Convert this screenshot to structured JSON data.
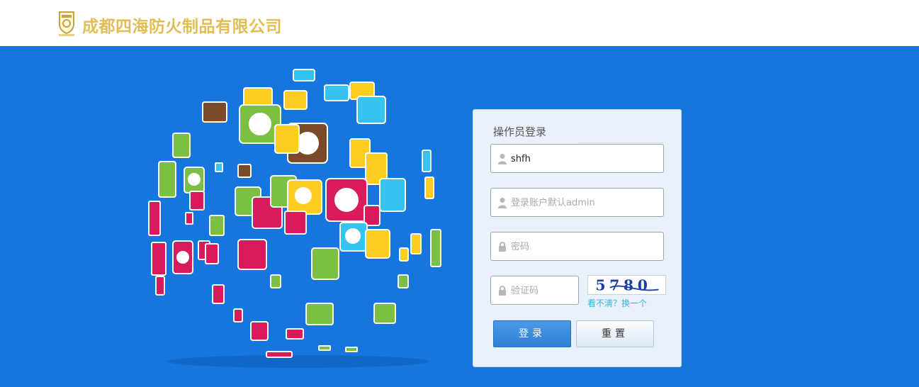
{
  "header": {
    "company_name": "成都四海防火制品有限公司",
    "logo": "shield-crest-logo",
    "brand_color": "#e0bd55"
  },
  "banner": {
    "background_color": "#1676dd",
    "illustration": "tile-globe-illustration"
  },
  "login": {
    "title": "操作员登录",
    "username": {
      "value": "shfh",
      "icon": "user-icon"
    },
    "account": {
      "value": "",
      "placeholder": "登录账户默认admin",
      "icon": "user-icon"
    },
    "password": {
      "value": "",
      "placeholder": "密码",
      "icon": "lock-icon"
    },
    "captcha": {
      "value": "",
      "placeholder": "验证码",
      "icon": "lock-icon",
      "image_text": "5780",
      "refresh_label": "看不清？换一个"
    },
    "login_label": "登录",
    "reset_label": "重置"
  }
}
